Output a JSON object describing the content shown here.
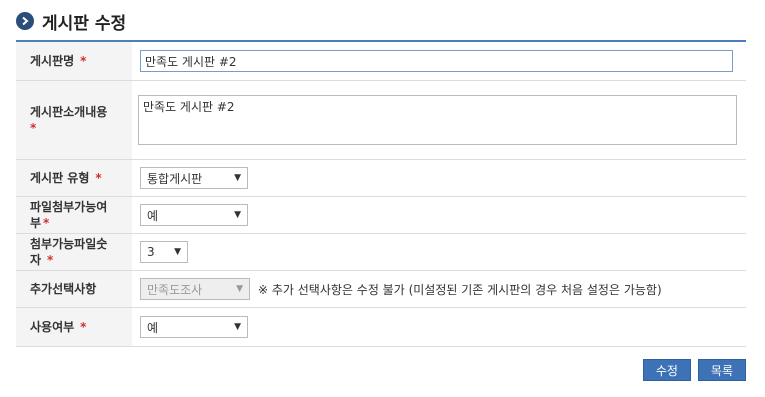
{
  "header": {
    "title": "게시판 수정",
    "icon": "chevron-right-icon"
  },
  "form": {
    "board_name": {
      "label": "게시판명",
      "required": "*",
      "value": "만족도 게시판 #2"
    },
    "board_description": {
      "label": "게시판소개내용",
      "required": "*",
      "value": "만족도 게시판 #2"
    },
    "board_type": {
      "label": "게시판 유형",
      "required": "*",
      "value": "통합게시판"
    },
    "file_attach": {
      "label_line1": "파일첨부가능여",
      "label_line2": "부",
      "required": "*",
      "value": "예"
    },
    "attach_count": {
      "label_line1": "첨부가능파일숫",
      "label_line2": "자",
      "required": "*",
      "value": "3"
    },
    "extra_option": {
      "label": "추가선택사항",
      "value": "만족도조사",
      "note": "※ 추가 선택사항은 수정 불가 (미설정된 기존 게시판의 경우 처음 설정은 가능함)"
    },
    "use_yn": {
      "label": "사용여부",
      "required": "*",
      "value": "예"
    }
  },
  "buttons": {
    "save": "수정",
    "list": "목록"
  },
  "colors": {
    "accent": "#3d73b6",
    "header_icon": "#2b4d7a",
    "required": "#d32f2f"
  }
}
